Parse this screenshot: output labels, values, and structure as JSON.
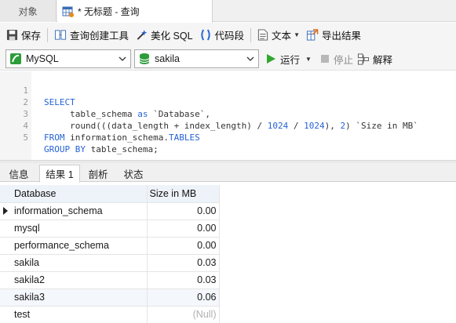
{
  "tabs": {
    "objects_label": "对象",
    "query_label": "* 无标题 - 查询"
  },
  "toolbar": {
    "save_label": "保存",
    "query_builder_label": "查询创建工具",
    "beautify_label": "美化 SQL",
    "snippet_label": "代码段",
    "text_label": "文本",
    "export_label": "导出结果"
  },
  "connection": {
    "db_type": "MySQL",
    "schema": "sakila",
    "run_label": "运行",
    "stop_label": "停止",
    "explain_label": "解释"
  },
  "editor": {
    "line_numbers": [
      "1",
      "2",
      "3",
      "4",
      "5"
    ],
    "lines": [
      "SELECT",
      "     table_schema as `Database`,",
      "     round(((data_length + index_length) / 1024 / 1024), 2) `Size in MB`",
      "FROM information_schema.TABLES",
      "GROUP BY table_schema;"
    ]
  },
  "result_tabs": [
    "信息",
    "结果 1",
    "剖析",
    "状态"
  ],
  "grid": {
    "columns": [
      "Database",
      "Size in MB"
    ],
    "rows": [
      {
        "db": "information_schema",
        "size": "0.00"
      },
      {
        "db": "mysql",
        "size": "0.00"
      },
      {
        "db": "performance_schema",
        "size": "0.00"
      },
      {
        "db": "sakila",
        "size": "0.03"
      },
      {
        "db": "sakila2",
        "size": "0.03"
      },
      {
        "db": "sakila3",
        "size": "0.06"
      },
      {
        "db": "test",
        "size": "(Null)"
      }
    ]
  },
  "colors": {
    "keyword": "#2563d6",
    "run_green": "#2fa82f",
    "header_bg": "#eef3fa"
  }
}
